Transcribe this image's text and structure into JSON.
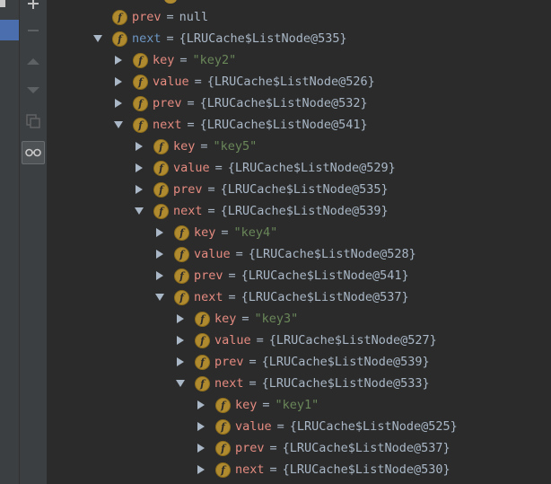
{
  "toolbar": {
    "buttons": [
      {
        "name": "add-watch-button",
        "icon": "plus-icon"
      },
      {
        "name": "remove-watch-button",
        "icon": "minus-icon"
      },
      {
        "name": "move-up-button",
        "icon": "arrow-up-icon"
      },
      {
        "name": "move-down-button",
        "icon": "arrow-down-icon"
      },
      {
        "name": "copy-button",
        "icon": "copy-icon"
      },
      {
        "name": "show-watches-button",
        "icon": "glasses-icon"
      }
    ]
  },
  "tree": {
    "rows": [
      {
        "depth": 0,
        "expand": "none",
        "name": "prev",
        "value": "null",
        "string": false,
        "highlight": false
      },
      {
        "depth": 0,
        "expand": "down",
        "name": "next",
        "value": "{LRUCache$ListNode@535}",
        "string": false,
        "highlight": true
      },
      {
        "depth": 1,
        "expand": "right",
        "name": "key",
        "value": "\"key2\"",
        "string": true,
        "highlight": false
      },
      {
        "depth": 1,
        "expand": "right",
        "name": "value",
        "value": "{LRUCache$ListNode@526}",
        "string": false,
        "highlight": false
      },
      {
        "depth": 1,
        "expand": "right",
        "name": "prev",
        "value": "{LRUCache$ListNode@532}",
        "string": false,
        "highlight": false
      },
      {
        "depth": 1,
        "expand": "down",
        "name": "next",
        "value": "{LRUCache$ListNode@541}",
        "string": false,
        "highlight": false
      },
      {
        "depth": 2,
        "expand": "right",
        "name": "key",
        "value": "\"key5\"",
        "string": true,
        "highlight": false
      },
      {
        "depth": 2,
        "expand": "right",
        "name": "value",
        "value": "{LRUCache$ListNode@529}",
        "string": false,
        "highlight": false
      },
      {
        "depth": 2,
        "expand": "right",
        "name": "prev",
        "value": "{LRUCache$ListNode@535}",
        "string": false,
        "highlight": false
      },
      {
        "depth": 2,
        "expand": "down",
        "name": "next",
        "value": "{LRUCache$ListNode@539}",
        "string": false,
        "highlight": false
      },
      {
        "depth": 3,
        "expand": "right",
        "name": "key",
        "value": "\"key4\"",
        "string": true,
        "highlight": false
      },
      {
        "depth": 3,
        "expand": "right",
        "name": "value",
        "value": "{LRUCache$ListNode@528}",
        "string": false,
        "highlight": false
      },
      {
        "depth": 3,
        "expand": "right",
        "name": "prev",
        "value": "{LRUCache$ListNode@541}",
        "string": false,
        "highlight": false
      },
      {
        "depth": 3,
        "expand": "down",
        "name": "next",
        "value": "{LRUCache$ListNode@537}",
        "string": false,
        "highlight": false
      },
      {
        "depth": 4,
        "expand": "right",
        "name": "key",
        "value": "\"key3\"",
        "string": true,
        "highlight": false
      },
      {
        "depth": 4,
        "expand": "right",
        "name": "value",
        "value": "{LRUCache$ListNode@527}",
        "string": false,
        "highlight": false
      },
      {
        "depth": 4,
        "expand": "right",
        "name": "prev",
        "value": "{LRUCache$ListNode@539}",
        "string": false,
        "highlight": false
      },
      {
        "depth": 4,
        "expand": "down",
        "name": "next",
        "value": "{LRUCache$ListNode@533}",
        "string": false,
        "highlight": false
      },
      {
        "depth": 5,
        "expand": "right",
        "name": "key",
        "value": "\"key1\"",
        "string": true,
        "highlight": false
      },
      {
        "depth": 5,
        "expand": "right",
        "name": "value",
        "value": "{LRUCache$ListNode@525}",
        "string": false,
        "highlight": false
      },
      {
        "depth": 5,
        "expand": "right",
        "name": "prev",
        "value": "{LRUCache$ListNode@537}",
        "string": false,
        "highlight": false
      },
      {
        "depth": 5,
        "expand": "right",
        "name": "next",
        "value": "{LRUCache$ListNode@530}",
        "string": false,
        "highlight": false
      }
    ],
    "field_icon_letter": "f",
    "equals": "="
  },
  "colors": {
    "field_name": "#e58b80",
    "highlight_name": "#6d97c4",
    "string_value": "#6a8759",
    "plain_value": "#a9b7c6",
    "field_icon": "#b08a2e"
  }
}
